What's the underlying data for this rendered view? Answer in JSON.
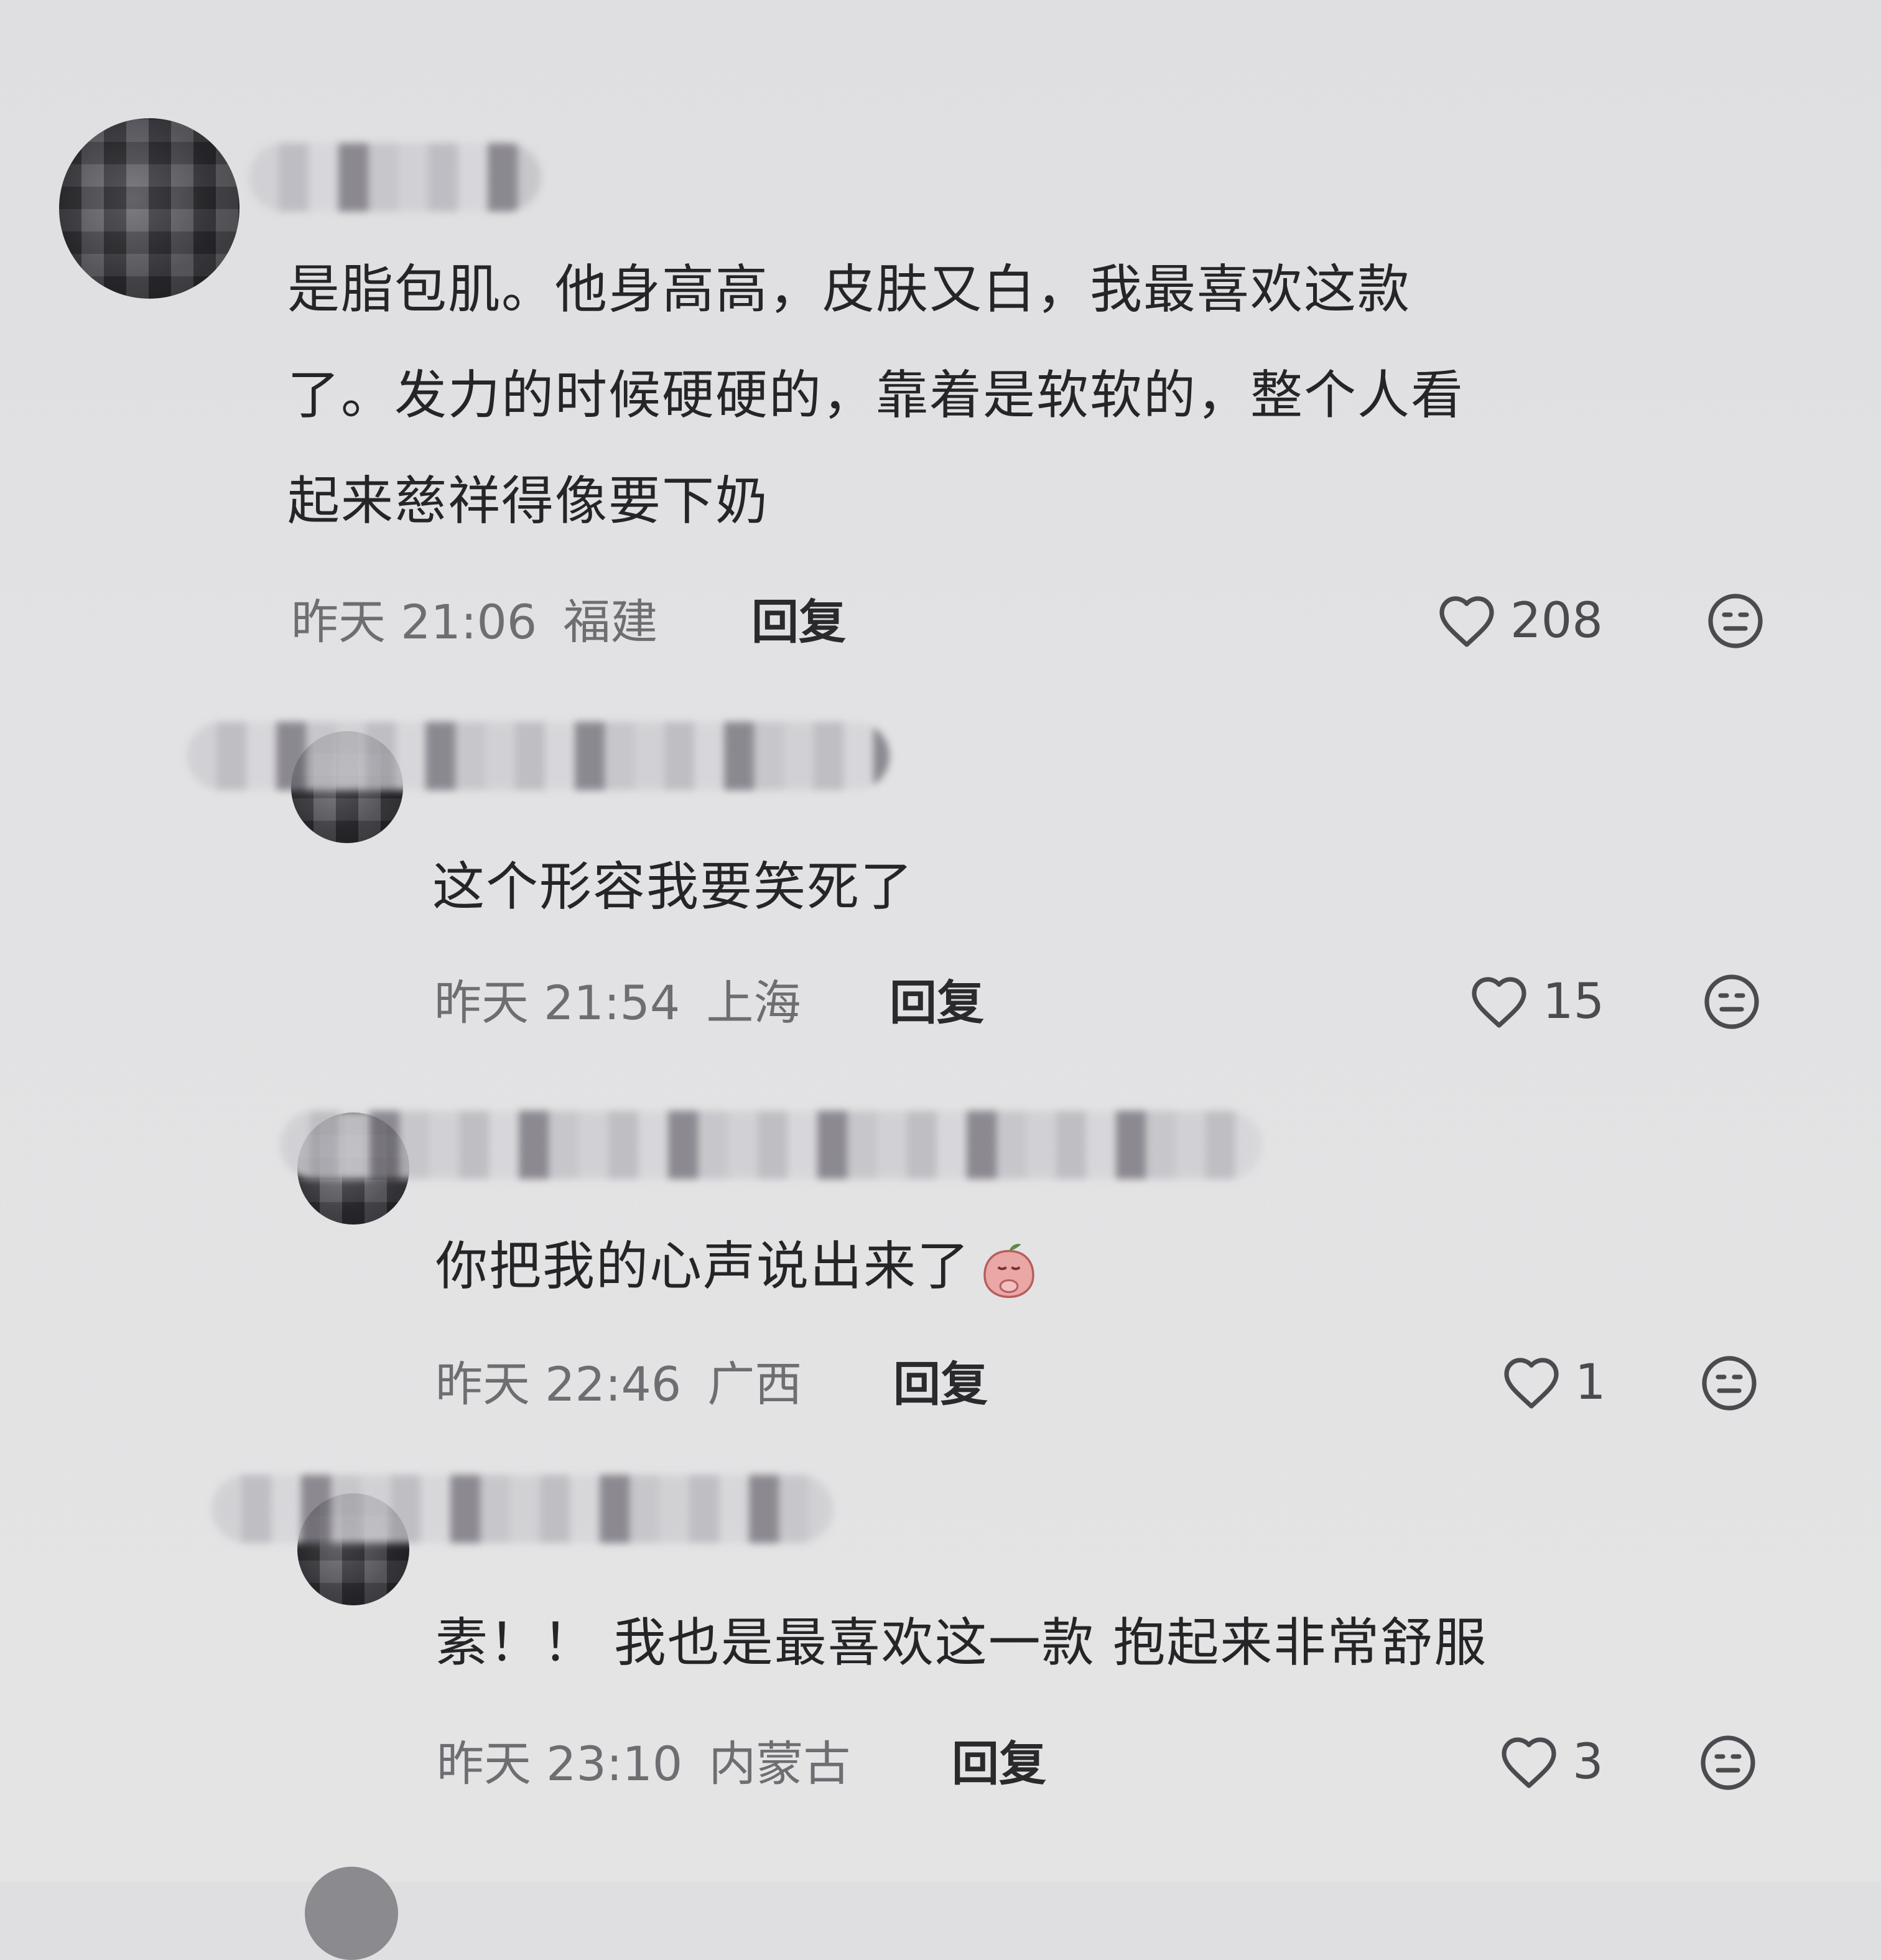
{
  "comments": [
    {
      "text_lines": [
        "是脂包肌。他身高高，皮肤又白，我最喜欢这款",
        "了。发力的时候硬硬的，靠着是软软的，整个人看",
        "起来慈祥得像要下奶"
      ],
      "date": "昨天 21:06",
      "location": "福建",
      "reply_label": "回复",
      "likes": "208"
    },
    {
      "text_lines": [
        "这个形容我要笑死了"
      ],
      "date": "昨天 21:54",
      "location": "上海",
      "reply_label": "回复",
      "likes": "15"
    },
    {
      "text_lines": [
        "你把我的心声说出来了"
      ],
      "emoji": "peach-praying-emoji",
      "date": "昨天 22:46",
      "location": "广西",
      "reply_label": "回复",
      "likes": "1"
    },
    {
      "text_lines": [
        "素！！ 我也是最喜欢这一款 抱起来非常舒服"
      ],
      "date": "昨天 23:10",
      "location": "内蒙古",
      "reply_label": "回复",
      "likes": "3"
    }
  ],
  "icons": {
    "like": "heart-outline-icon",
    "more": "dislike-face-icon"
  },
  "colors": {
    "background": "#e1e1e3",
    "text": "#252527",
    "meta": "#6d6d72"
  }
}
